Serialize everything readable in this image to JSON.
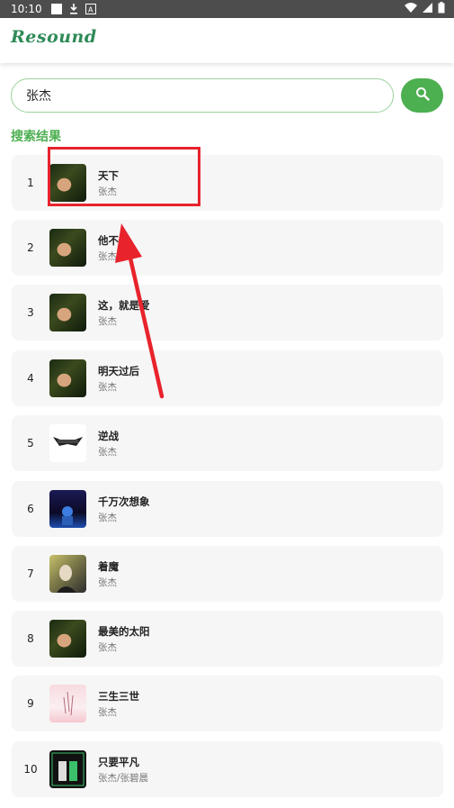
{
  "status": {
    "time": "10:10",
    "icons": [
      "notification-square-icon",
      "download-icon",
      "a-icon",
      "wifi-icon",
      "signal-icon",
      "battery-icon"
    ]
  },
  "app": {
    "logo": "Resound"
  },
  "search": {
    "value": "张杰",
    "button_icon": "search-icon"
  },
  "section": {
    "title": "搜索结果"
  },
  "results": [
    {
      "index": "1",
      "title": "天下",
      "artist": "张杰",
      "cover": "face"
    },
    {
      "index": "2",
      "title": "他不懂",
      "artist": "张杰",
      "cover": "face"
    },
    {
      "index": "3",
      "title": "这，就是爱",
      "artist": "张杰",
      "cover": "face"
    },
    {
      "index": "4",
      "title": "明天过后",
      "artist": "张杰",
      "cover": "face"
    },
    {
      "index": "5",
      "title": "逆战",
      "artist": "张杰",
      "cover": "war"
    },
    {
      "index": "6",
      "title": "千万次想象",
      "artist": "张杰",
      "cover": "blue"
    },
    {
      "index": "7",
      "title": "着魔",
      "artist": "张杰",
      "cover": "girl"
    },
    {
      "index": "8",
      "title": "最美的太阳",
      "artist": "张杰",
      "cover": "face"
    },
    {
      "index": "9",
      "title": "三生三世",
      "artist": "张杰",
      "cover": "pink"
    },
    {
      "index": "10",
      "title": "只要平凡",
      "artist": "张杰/张碧晨",
      "cover": "dark"
    }
  ],
  "annotation": {
    "color": "#e8232c"
  }
}
